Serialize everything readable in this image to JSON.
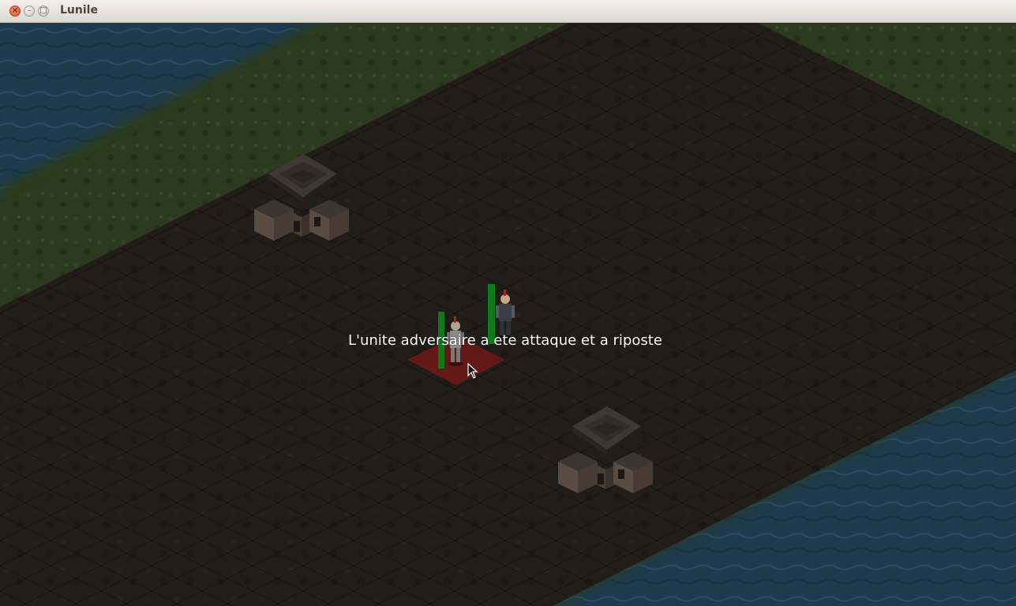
{
  "window": {
    "title": "Lunile",
    "controls": {
      "close": "×",
      "minimize": "–",
      "maximize": "□"
    }
  },
  "game": {
    "status_message": "L'unite adversaire a ete attaque et a riposte",
    "units": [
      {
        "name": "selected-unit",
        "health": 1.0
      },
      {
        "name": "enemy-unit",
        "health": 1.0
      }
    ],
    "buildings": [
      "house",
      "house"
    ]
  },
  "colors": {
    "water": "#1f3a4c",
    "grass": "#2e3a1f",
    "ground": "#2a2520",
    "grid": "#1a1714",
    "selection": "#8b1a1a",
    "health": "#0f7a1a"
  }
}
